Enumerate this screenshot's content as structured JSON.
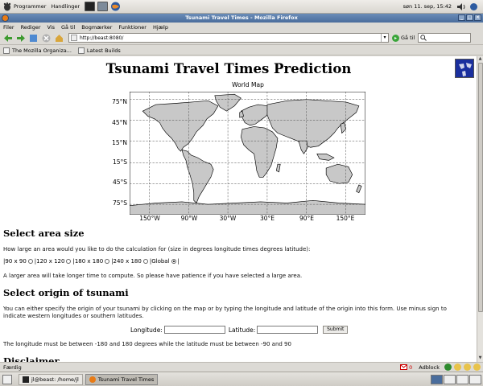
{
  "desktop": {
    "menus": [
      "Programmer",
      "Handlinger"
    ],
    "clock": "søn 11. sep, 15:42"
  },
  "browser": {
    "window_title": "Tsunami Travel Times - Mozilla Firefox",
    "menu": [
      "Filer",
      "Rediger",
      "Vis",
      "Gå til",
      "Bogmærker",
      "Funktioner",
      "Hjælp"
    ],
    "url": "http://beast:8080/",
    "goto_label": "Gå til",
    "bookmarks": [
      "The Mozilla Organiza...",
      "Latest Builds"
    ],
    "status_text": "Færdig",
    "status_mail": "0",
    "status_adblock": "Adblock"
  },
  "page": {
    "title": "Tsunami Travel Times Prediction",
    "map_title": "World Map",
    "map_lat_ticks": [
      "75°N",
      "45°N",
      "15°N",
      "15°S",
      "45°S",
      "75°S"
    ],
    "map_lon_ticks": [
      "150°W",
      "90°W",
      "30°W",
      "30°E",
      "90°E",
      "150°E"
    ],
    "area_heading": "Select area size",
    "area_question": "How large an area would you like to do the calculation for (size in degrees longitude times degrees latitude):",
    "area_options": [
      "90 x 90",
      "120 x 120",
      "180 x 180",
      "240 x 180",
      "Global"
    ],
    "area_selected": "Global",
    "area_note": "A larger area will take longer time to compute. So please have patience if you have selected a large area.",
    "origin_heading": "Select origin of tsunami",
    "origin_text": "You can either specify the origin of your tsunami by clicking on the map or by typing the longitude and latitude of the origin into this form. Use minus sign to indicate western longitudes or southern latitudes.",
    "longitude_label": "Longitude:",
    "latitude_label": "Latitude:",
    "submit_label": "Submit",
    "range_note": "The longitude must be between -180 and 180 degrees while the latitude must be between -90 and 90",
    "disclaimer_heading": "Disclaimer"
  },
  "taskbar": {
    "tasks": [
      "jl@beast: /home/jl",
      "Tsunami Travel Times"
    ]
  },
  "colors": {
    "land": "#c8c8c8",
    "ocean": "#ffffff",
    "title_bar": "#4a6d9c"
  }
}
